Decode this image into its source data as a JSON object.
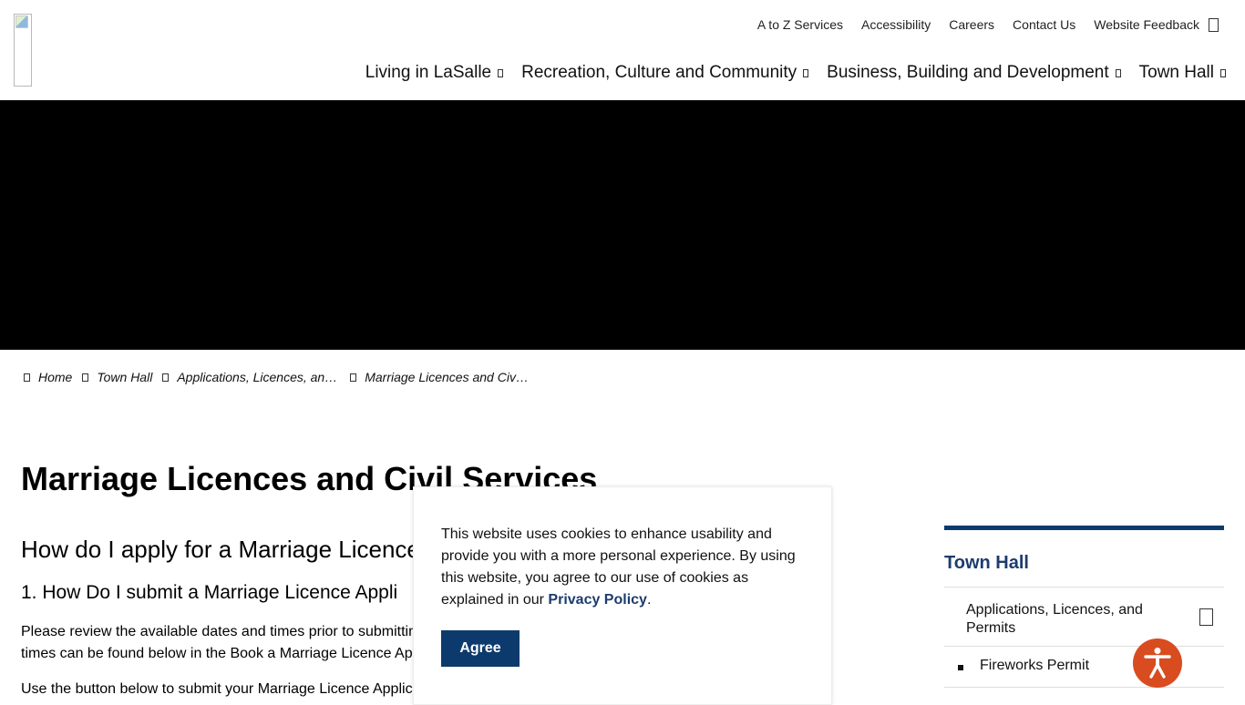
{
  "utility_nav": [
    "A to Z Services",
    "Accessibility",
    "Careers",
    "Contact Us",
    "Website Feedback"
  ],
  "main_nav": [
    "Living in LaSalle",
    "Recreation, Culture and Community",
    "Business, Building and Development",
    "Town Hall"
  ],
  "breadcrumb": [
    "Home",
    "Town Hall",
    "Applications, Licences, an…",
    "Marriage Licences and Civ…"
  ],
  "page": {
    "title": "Marriage Licences and Civil Services",
    "h2": "How do I apply for a Marriage Licence",
    "h3": "1. How Do I submit a Marriage Licence Appli",
    "para1": "Please review the available dates and times prior to submittin times can be found below in the Book a Marriage Licence Ap",
    "para2": "Use the button below to submit your Marriage Licence Applic"
  },
  "cookie": {
    "message": "This website uses cookies to enhance usability and provide you with a more personal experience. By using this website, you agree to our use of cookies as explained in our",
    "link": "Privacy Policy",
    "end": ".",
    "agree": "Agree"
  },
  "sidebar": {
    "title": "Town Hall",
    "item": "Applications, Licences, and Permits",
    "sub_item": "Fireworks Permit"
  },
  "colors": {
    "accent": "#0d3a6c",
    "link": "#1d3c6e",
    "accessibility_button": "#d84c1f",
    "hero": "#000000"
  },
  "icons": {
    "search": "search-icon",
    "caret": "chevron-down-icon",
    "breadcrumb_separator": "chevron-right-icon",
    "accessibility": "accessibility-icon"
  }
}
